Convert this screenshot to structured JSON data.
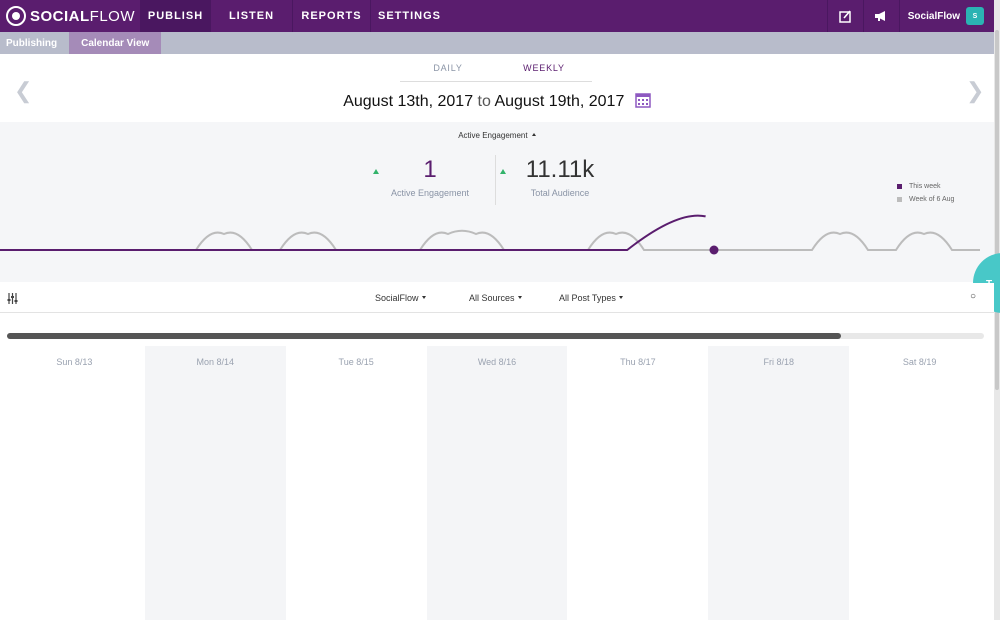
{
  "app": {
    "logo_text_bold": "SOCIAL",
    "logo_text_light": "FLOW",
    "logo_icon": "socialflow-logo-icon"
  },
  "topnav": {
    "items": [
      {
        "label": "PUBLISH",
        "active": true
      },
      {
        "label": "LISTEN",
        "active": false
      },
      {
        "label": "REPORTS",
        "active": false
      },
      {
        "label": "SETTINGS",
        "active": false
      }
    ],
    "compose_icon": "compose-icon",
    "announce_icon": "megaphone-icon",
    "user_name": "SocialFlow",
    "avatar_letter": "S"
  },
  "subnav": {
    "items": [
      {
        "label": "Publishing",
        "active": false
      },
      {
        "label": "Calendar View",
        "active": true
      }
    ]
  },
  "period_tabs": [
    {
      "label": "DAILY",
      "active": false
    },
    {
      "label": "WEEKLY",
      "active": true
    }
  ],
  "date_range": {
    "start": "August 13th, 2017",
    "connector": "to",
    "end": "August 19th, 2017"
  },
  "engagement": {
    "selector_label": "Active Engagement",
    "metrics": [
      {
        "value": "1",
        "label": "Active Engagement",
        "trend": "up"
      },
      {
        "value": "11.11k",
        "label": "Total Audience",
        "trend": "up"
      }
    ],
    "legend": [
      {
        "label": "This week",
        "color": "#5a1d6e"
      },
      {
        "label": "Week of 6 Aug",
        "color": "#bcbcbc"
      }
    ]
  },
  "chart_data": {
    "type": "line",
    "series": [
      {
        "name": "This week",
        "color": "#5a1d6e",
        "values": [
          0,
          0,
          0,
          0,
          0,
          0,
          0,
          0,
          0,
          1
        ]
      },
      {
        "name": "Week of 6 Aug",
        "color": "#bcbcbc",
        "values": [
          0,
          0,
          0,
          0,
          0,
          0,
          0,
          0,
          1,
          0,
          0,
          1,
          0,
          0,
          0,
          0,
          1,
          1,
          0,
          0,
          0,
          0,
          1,
          0,
          0,
          0,
          0,
          0,
          0,
          0,
          1,
          0,
          0,
          1,
          0,
          0
        ]
      }
    ]
  },
  "filters": {
    "icon": "sliders-icon",
    "items": [
      {
        "label": "SocialFlow"
      },
      {
        "label": "All Sources"
      },
      {
        "label": "All Post Types"
      }
    ]
  },
  "bubble_text": "T",
  "calendar": {
    "days": [
      {
        "label": "Sun 8/13"
      },
      {
        "label": "Mon 8/14"
      },
      {
        "label": "Tue 8/15"
      },
      {
        "label": "Wed 8/16"
      },
      {
        "label": "Thu 8/17"
      },
      {
        "label": "Fri 8/18"
      },
      {
        "label": "Sat 8/19"
      }
    ]
  }
}
